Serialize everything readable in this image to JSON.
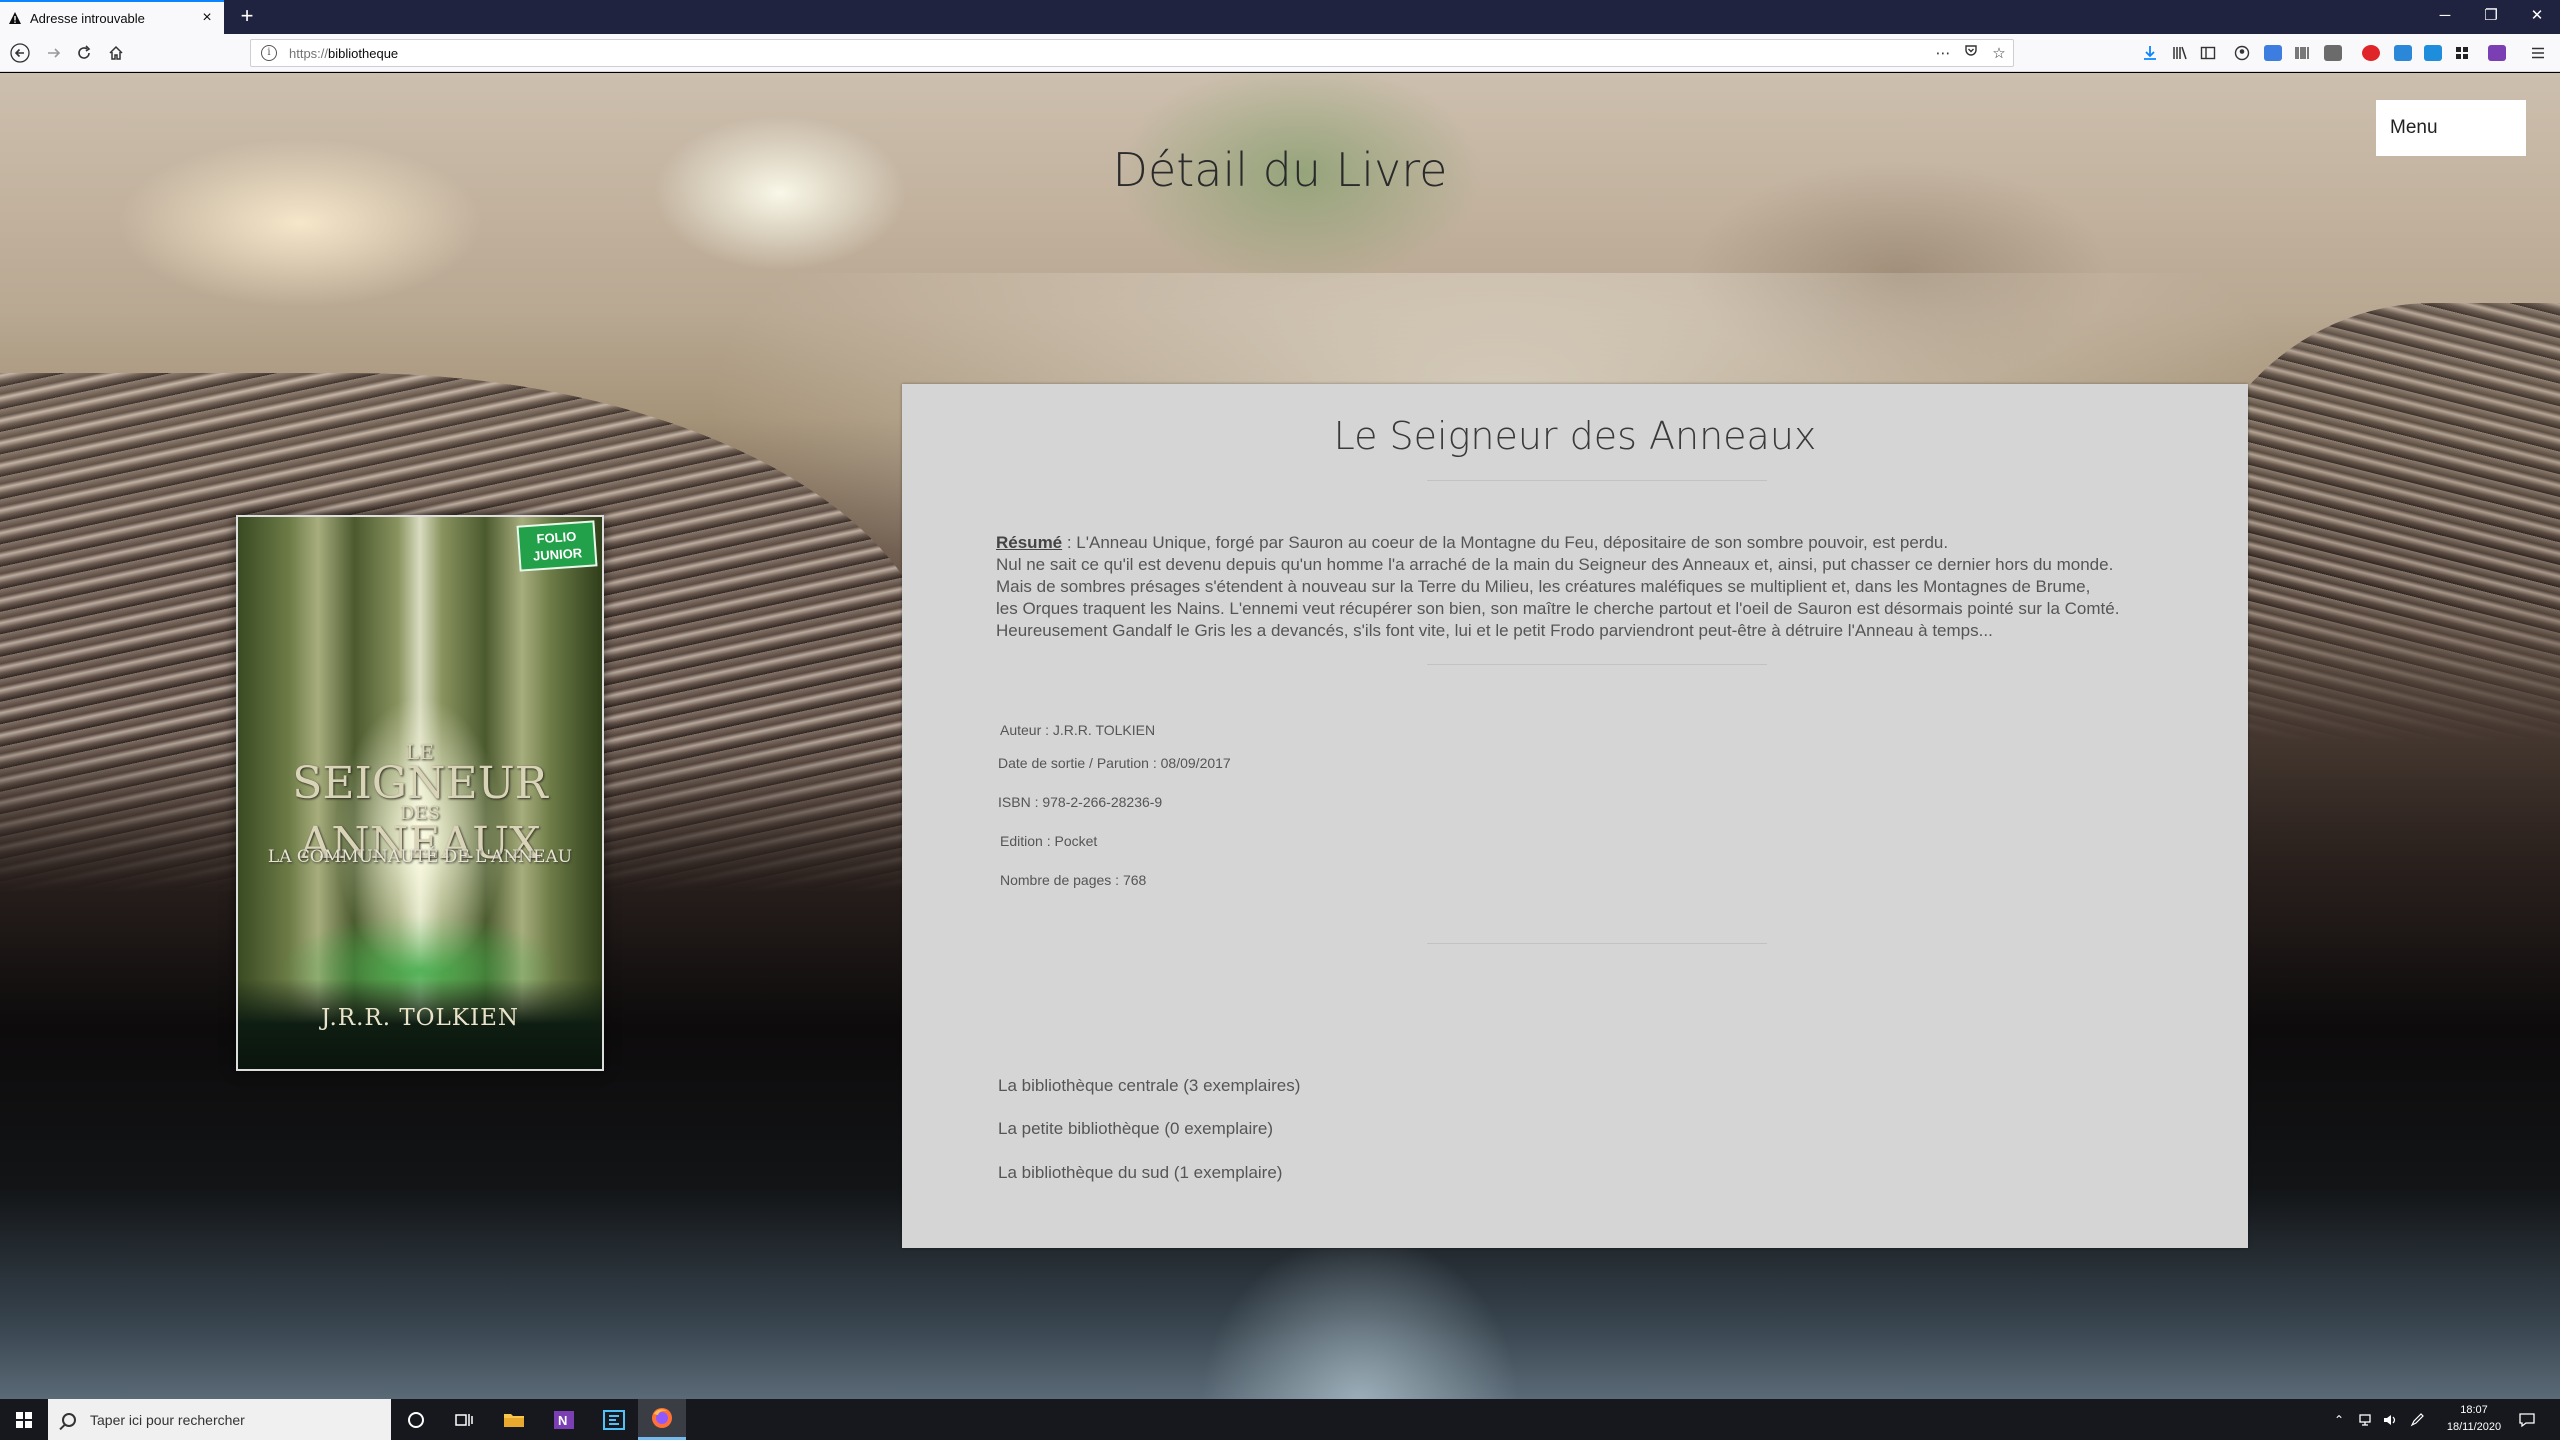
{
  "browser": {
    "tab_title": "Adresse introuvable",
    "tab_close": "×",
    "new_tab": "+",
    "url_protocol": "https://",
    "url_host": "bibliotheque",
    "controls": {
      "minimize": "─",
      "restore": "❐",
      "close": "✕"
    }
  },
  "page": {
    "title": "Détail du Livre",
    "menu_label": "Menu"
  },
  "cover": {
    "badge": "FOLIO JUNIOR",
    "title_line1": "LE",
    "title_line2": "SEIGNEUR",
    "title_line3": "DES",
    "title_line4": "ANNEAUX",
    "subtitle": "LA COMMUNAUTÉ DE L'ANNEAU",
    "author": "J.R.R. TOLKIEN"
  },
  "book": {
    "title": "Le Seigneur des Anneaux",
    "summary_label": "Résumé",
    "summary_lines": [
      " : L'Anneau Unique, forgé par Sauron au coeur de la Montagne du Feu, dépositaire de son sombre pouvoir, est perdu.",
      "Nul ne sait ce qu'il est devenu depuis qu'un homme l'a arraché de la main du Seigneur des Anneaux et, ainsi, put chasser ce dernier hors du monde.",
      "Mais de sombres présages s'étendent à nouveau sur la Terre du Milieu, les créatures maléfiques se multiplient et, dans les Montagnes de Brume,",
      "les Orques traquent les Nains. L'ennemi veut récupérer son bien, son maître le cherche partout et l'oeil de Sauron est désormais pointé sur la Comté.",
      "Heureusement Gandalf le Gris les a devancés, s'ils font vite, lui et le petit Frodo parviendront peut-être à détruire l'Anneau à temps..."
    ],
    "author": "Auteur : J.R.R. TOLKIEN",
    "release_date": "Date de sortie / Parution : 08/09/2017",
    "isbn": "ISBN : 978-2-266-28236-9",
    "edition": "Edition : Pocket",
    "pages": "Nombre de pages : 768"
  },
  "libraries": [
    "La bibliothèque centrale (3 exemplaires)",
    "La petite bibliothèque (0 exemplaire)",
    "La bibliothèque du sud (1 exemplaire)"
  ],
  "taskbar": {
    "search_placeholder": "Taper ici pour rechercher",
    "time": "18:07",
    "date": "18/11/2020"
  }
}
